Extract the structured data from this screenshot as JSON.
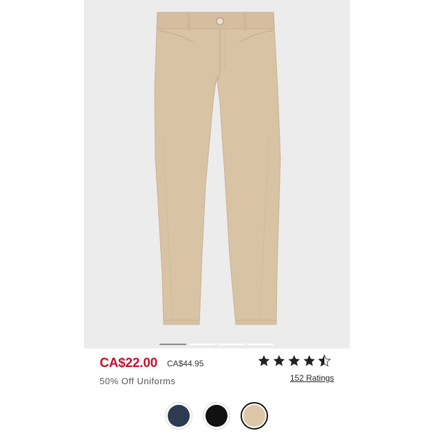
{
  "product": {
    "sale_price": "CA$22.00",
    "original_price": "CA$44.95",
    "promo_text": "50% Off Uniforms",
    "sale_price_color": "#c8102e",
    "image_background": "#ececec",
    "product_color": "#d8c3a5"
  },
  "carousel": {
    "slide_count": 4,
    "active_index": 0
  },
  "rating": {
    "stars": 4.5,
    "max_stars": 5,
    "ratings_label": "152 Ratings"
  },
  "swatches": [
    {
      "name": "navy",
      "color": "#2c3a52",
      "selected": false
    },
    {
      "name": "black",
      "color": "#111111",
      "selected": false
    },
    {
      "name": "khaki",
      "color": "#ddc7a8",
      "selected": true
    }
  ]
}
